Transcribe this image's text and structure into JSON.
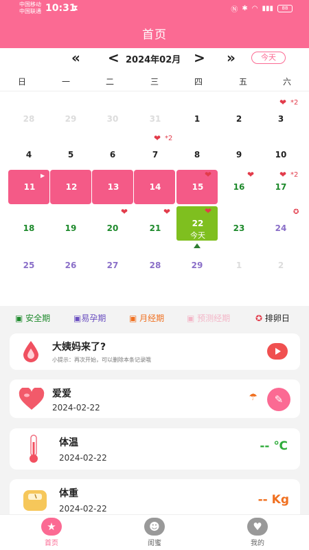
{
  "status": {
    "carrier1": "中国移动",
    "carrier2": "中国联通",
    "time": "10:31",
    "battery": "88"
  },
  "header": {
    "title": "首页"
  },
  "nav": {
    "month": "2024年02月",
    "prev_year": "«",
    "prev": "<",
    "next": ">",
    "next_year": "»",
    "today": "今天"
  },
  "weekdays": [
    "日",
    "一",
    "二",
    "三",
    "四",
    "五",
    "六"
  ],
  "calendar": {
    "row1": [
      "28",
      "29",
      "30",
      "31",
      "1",
      "2",
      "3"
    ],
    "row2": [
      "4",
      "5",
      "6",
      "7",
      "8",
      "9",
      "10"
    ],
    "row3": [
      "11",
      "12",
      "13",
      "14",
      "15",
      "16",
      "17"
    ],
    "row4": [
      "18",
      "19",
      "20",
      "21",
      "22",
      "23",
      "24"
    ],
    "row5": [
      "25",
      "26",
      "27",
      "28",
      "29",
      "1",
      "2"
    ],
    "today_label": "今天",
    "mark_x2": "*2"
  },
  "legend": {
    "safe": "安全期",
    "fertile": "易孕期",
    "period": "月经期",
    "predicted": "预测经期",
    "ovulation": "排卵日"
  },
  "cards": {
    "period": {
      "title": "大姨妈来了?",
      "hint": "小提示：再次开始，可以删除本条记录哦"
    },
    "love": {
      "title": "爱爱",
      "date": "2024-02-22"
    },
    "temp": {
      "title": "体温",
      "date": "2024-02-22",
      "value": "-- ℃"
    },
    "weight": {
      "title": "体重",
      "date": "2024-02-22",
      "value": "-- Kg"
    }
  },
  "bottom_nav": {
    "home": "首页",
    "friends": "闺蜜",
    "mine": "我的"
  },
  "colors": {
    "brand": "#fb6a93",
    "period": "#f45a87",
    "today": "#7fbf1f",
    "safe": "#1e8a2c",
    "fertile": "#8a6fc8"
  }
}
